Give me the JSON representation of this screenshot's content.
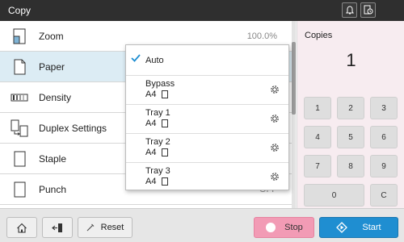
{
  "app": {
    "title": "Copy"
  },
  "settings": [
    {
      "label": "Zoom",
      "value": "100.0%"
    },
    {
      "label": "Paper",
      "value": ""
    },
    {
      "label": "Density",
      "value": ""
    },
    {
      "label": "Duplex Settings",
      "value": ""
    },
    {
      "label": "Staple",
      "value": ""
    },
    {
      "label": "Punch",
      "value": "OFF"
    }
  ],
  "paper_dropdown": {
    "selected": "Auto",
    "items": [
      {
        "name": "Auto"
      },
      {
        "name": "Bypass",
        "size": "A4"
      },
      {
        "name": "Tray  1",
        "size": "A4"
      },
      {
        "name": "Tray  2",
        "size": "A4"
      },
      {
        "name": "Tray  3",
        "size": "A4"
      }
    ]
  },
  "copies": {
    "label": "Copies",
    "value": "1",
    "keypad": [
      "1",
      "2",
      "3",
      "4",
      "5",
      "6",
      "7",
      "8",
      "9",
      "0",
      "C"
    ]
  },
  "bottom_bar": {
    "reset_label": "Reset",
    "stop_label": "Stop",
    "start_label": "Start"
  },
  "colors": {
    "topbar": "#2f2f2f",
    "selected_row": "#dcecf4",
    "copies_panel": "#f7ecf0",
    "stop": "#f29bb5",
    "start": "#1f8ed1"
  }
}
